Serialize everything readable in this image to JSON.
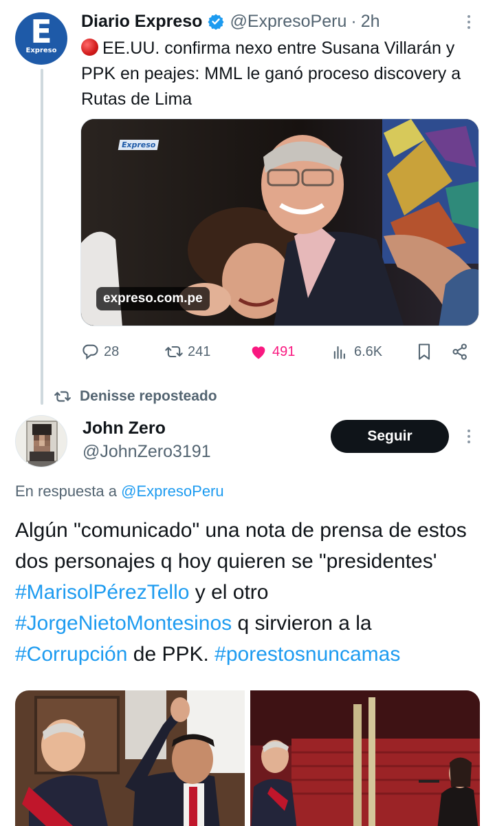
{
  "tweet1": {
    "author_name": "Diario Expreso",
    "handle": "@ExpresoPeru",
    "separator": "·",
    "time": "2h",
    "avatar_letter": "E",
    "avatar_word": "Expreso",
    "text": "EE.UU. confirma nexo entre Susana Villarán y PPK en peajes: MML le ganó proceso discovery a Rutas de Lima",
    "image": {
      "watermark": "Expreso",
      "link_chip": "expreso.com.pe"
    },
    "stats": {
      "replies": "28",
      "reposts": "241",
      "likes": "491",
      "views": "6.6K"
    }
  },
  "repost_banner": {
    "text": "Denisse reposteado"
  },
  "tweet2": {
    "author_name": "John Zero",
    "handle": "@JohnZero3191",
    "follow_label": "Seguir",
    "reply_prefix": "En respuesta a",
    "reply_to": "@ExpresoPeru",
    "text_segments": [
      {
        "text": "Algún \"comunicado\" una nota de prensa de estos dos personajes q hoy quieren se \"presidentes' ",
        "hashtag": false
      },
      {
        "text": "#MarisolPérezTello",
        "hashtag": true
      },
      {
        "text": " y el otro ",
        "hashtag": false
      },
      {
        "text": "#JorgeNietoMontesinos",
        "hashtag": true
      },
      {
        "text": " q sirvieron a la ",
        "hashtag": false
      },
      {
        "text": "#Corrupción",
        "hashtag": true
      },
      {
        "text": " de PPK. ",
        "hashtag": false
      },
      {
        "text": "#porestosnuncamas",
        "hashtag": true
      }
    ]
  },
  "colors": {
    "accent": "#1d9bf0",
    "like": "#f91880",
    "muted": "#536471",
    "follow_button": "#0f1419",
    "expreso_brand": "#1e5aa8"
  },
  "icons": {
    "verified": "verified-badge-icon",
    "reply": "reply-bubble-icon",
    "repost": "repost-arrows-icon",
    "like": "heart-icon",
    "views": "bar-chart-icon",
    "bookmark": "bookmark-icon",
    "share": "share-icon",
    "more": "more-dots-icon"
  }
}
